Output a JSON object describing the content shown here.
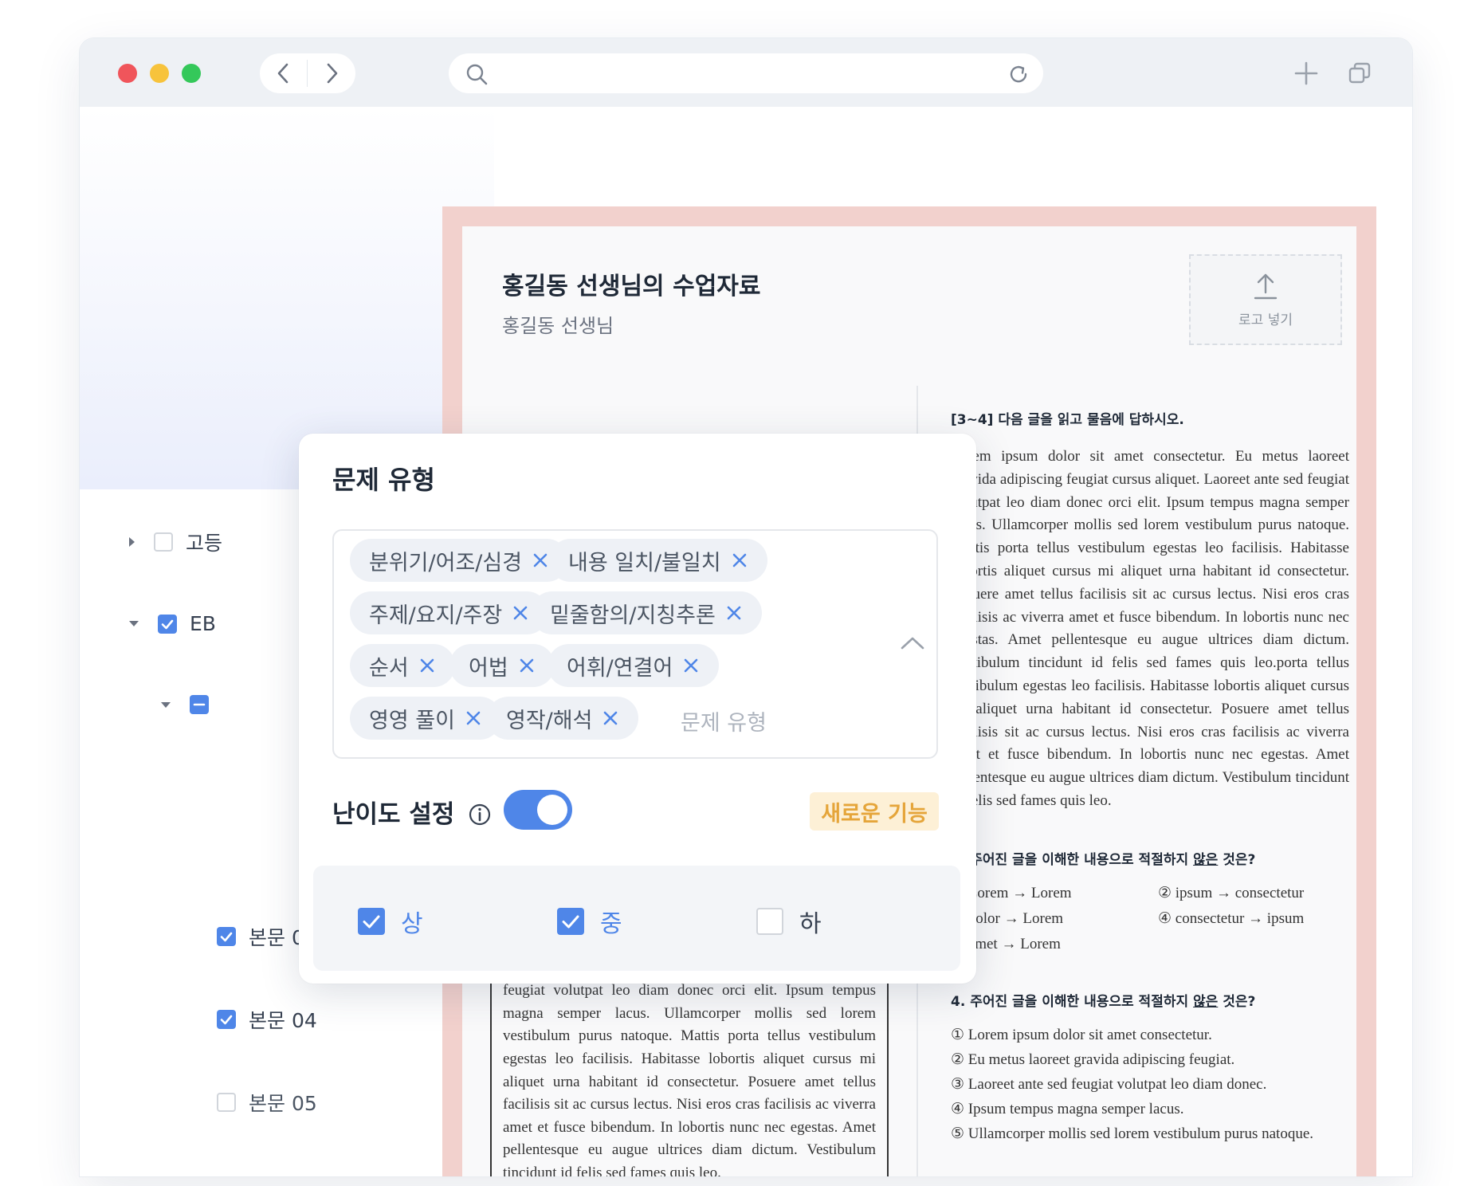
{
  "browser": {
    "window_controls": [
      "close",
      "minimize",
      "zoom"
    ],
    "colors": {
      "close": "#f0555b",
      "minimize": "#f7c33c",
      "zoom": "#34c85a",
      "accent": "#4f86e8",
      "sheet_frame": "#f2d1cd",
      "badge_text": "#e5a53a"
    },
    "address_value": ""
  },
  "sidebar": {
    "items": [
      {
        "label": "고등",
        "state": "unchecked",
        "expanded": false
      },
      {
        "label": "EB",
        "state": "checked",
        "expanded": true
      },
      {
        "label": "",
        "state": "indeterminate",
        "expanded": true
      },
      {
        "label": "본문 03",
        "state": "checked"
      },
      {
        "label": "본문 04",
        "state": "checked"
      },
      {
        "label": "본문 05",
        "state": "unchecked"
      }
    ]
  },
  "document": {
    "title": "홍길동 선생님의 수업자료",
    "subtitle": "홍길동 선생님",
    "logo_button": "로고 넣기",
    "instruction": "[3~4] 다음 글을 읽고 물음에 답하시오.",
    "paragraph": "Lorem ipsum dolor sit amet consectetur. Eu metus laoreet gravida adipiscing feugiat cursus aliquet. Laoreet ante sed feugiat volutpat leo diam donec orci elit. Ipsum tempus magna semper lacus. Ullamcorper mollis sed lorem vestibulum purus natoque. Mattis porta tellus vestibulum egestas leo facilisis. Habitasse lobortis aliquet cursus mi aliquet urna habitant id consectetur. Posuere amet tellus facilisis sit ac cursus lectus. Nisi eros cras facilisis ac viverra amet et fusce bibendum. In lobortis nunc nec egestas. Amet pellentesque eu augue ultrices diam dictum. Vestibulum tincidunt id felis sed fames quis leo.porta tellus vestibulum egestas leo facilisis. Habitasse lobortis aliquet cursus mi aliquet urna habitant id consectetur. Posuere amet tellus facilisis sit ac cursus lectus. Nisi eros cras facilisis ac viverra amet et fusce bibendum. In lobortis nunc nec egestas. Amet pellentesque eu augue ultrices diam dictum. Vestibulum tincidunt id felis sed fames quis leo.",
    "q3": {
      "prefix": "3. 주어진 글을 이해한 내용으로 적절하지 ",
      "underlined": "않은",
      "suffix": " 것은?",
      "options": [
        "① Lorem → Lorem",
        "② ipsum → consectetur",
        "③ dolor → Lorem",
        "④ consectetur → ipsum",
        "⑤ amet → Lorem"
      ]
    },
    "q4": {
      "prefix": "4. 주어진 글을 이해한 내용으로 적절하지 ",
      "underlined": "않은",
      "suffix": " 것은?",
      "options": [
        "① Lorem ipsum dolor sit amet consectetur.",
        "② Eu metus laoreet gravida adipiscing feugiat.",
        "③ Laoreet ante sed feugiat volutpat leo diam donec.",
        "④ Ipsum tempus magna semper lacus.",
        "⑤ Ullamcorper mollis sed lorem vestibulum purus natoque."
      ]
    },
    "passage": "Lorem ipsum dolor sit amet consectetur. Eu metus laoreet gravida adipiscing feugiat cursus aliquet. Laoreet ante sed feugiat volutpat leo diam donec orci elit. Ipsum tempus magna semper lacus. Ullamcorper mollis sed lorem vestibulum purus natoque. Mattis porta tellus vestibulum egestas leo facilisis. Habitasse lobortis aliquet cursus mi aliquet urna habitant id consectetur. Posuere amet tellus facilisis sit ac cursus lectus. Nisi eros cras facilisis ac viverra amet et fusce bibendum. In lobortis nunc nec egestas. Amet pellentesque eu augue ultrices diam dictum. Vestibulum tincidunt id felis sed fames quis leo."
  },
  "popup": {
    "title": "문제 유형",
    "tags": [
      "분위기/어조/심경",
      "내용 일치/불일치",
      "주제/요지/주장",
      "밑줄함의/지칭추론",
      "순서",
      "어법",
      "어휘/연결어",
      "영영 풀이",
      "영작/해석"
    ],
    "placeholder": "문제 유형",
    "difficulty_label": "난이도 설정",
    "difficulty_enabled": true,
    "new_badge": "새로운 기능",
    "levels": [
      {
        "label": "상",
        "checked": true
      },
      {
        "label": "중",
        "checked": true
      },
      {
        "label": "하",
        "checked": false
      }
    ]
  }
}
